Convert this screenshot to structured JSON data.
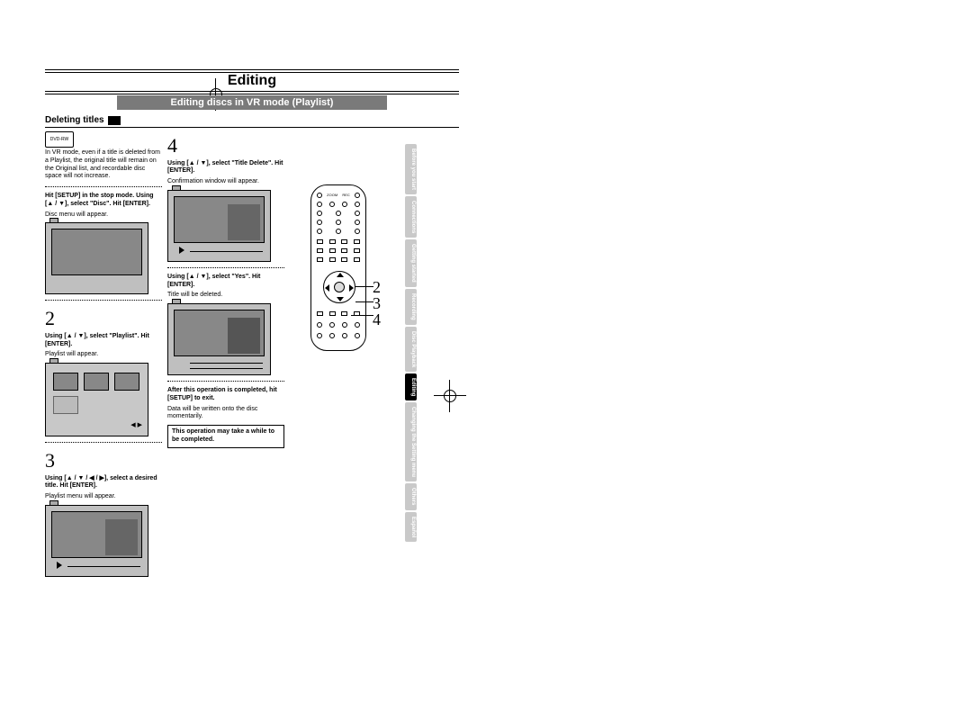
{
  "header": {
    "title": "Editing",
    "subtitle": "Editing discs in VR mode (Playlist)"
  },
  "section": {
    "title": "Deleting titles"
  },
  "intro": "In VR mode, even if a title is deleted from a Playlist, the original title will remain on the Original list, and recordable disc space will not increase.",
  "step1": {
    "instr": "Hit [SETUP] in the stop mode. Using [▲ / ▼], select \"Disc\". Hit [ENTER].",
    "result": "Disc menu will appear."
  },
  "step2": {
    "num": "2",
    "instr": "Using [▲ / ▼], select \"Playlist\". Hit [ENTER].",
    "result": "Playlist will appear."
  },
  "step3": {
    "num": "3",
    "instr": "Using [▲ / ▼ / ◀ / ▶], select a desired title. Hit [ENTER].",
    "result": "Playlist menu will appear."
  },
  "step4": {
    "num": "4",
    "instr": "Using [▲ / ▼], select \"Title Delete\". Hit [ENTER].",
    "result": "Confirmation window will appear."
  },
  "step5": {
    "instr": "Using [▲ / ▼], select \"Yes\". Hit [ENTER].",
    "result": "Title will be deleted."
  },
  "after": {
    "line1": "After this operation is completed, hit [SETUP] to exit.",
    "line2": "Data will be written onto the disc momentarily.",
    "note": "This operation may take a while to be completed."
  },
  "remote_callouts": [
    "2",
    "3",
    "4"
  ],
  "tabs": [
    "Before you start",
    "Connections",
    "Getting started",
    "Recording",
    "Disc Playback",
    "Editing",
    "Changing the Setting menu",
    "Others",
    "Español"
  ]
}
